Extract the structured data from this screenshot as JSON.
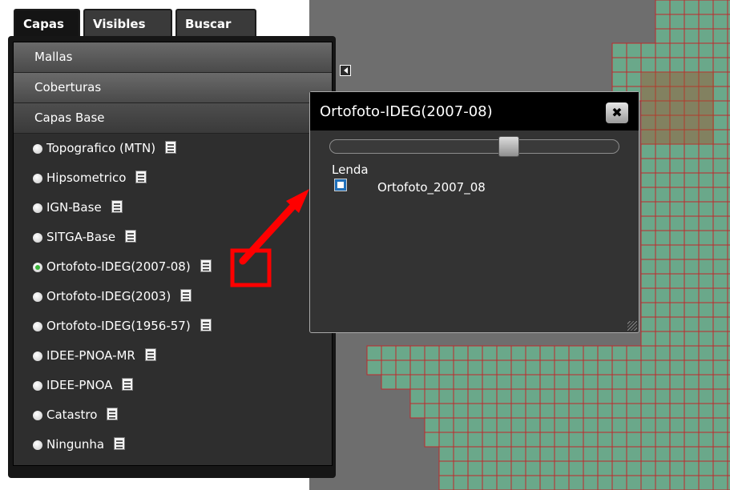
{
  "tabs": [
    {
      "label": "Capas",
      "active": true
    },
    {
      "label": "Visibles",
      "active": false
    },
    {
      "label": "Buscar",
      "active": false
    }
  ],
  "sections": {
    "mallas": "Mallas",
    "coberturas": "Coberturas",
    "capas_base": "Capas Base"
  },
  "layers": [
    {
      "label": "Topografico (MTN)",
      "checked": false
    },
    {
      "label": "Hipsometrico",
      "checked": false
    },
    {
      "label": "IGN-Base",
      "checked": false
    },
    {
      "label": "SITGA-Base",
      "checked": false
    },
    {
      "label": "Ortofoto-IDEG(2007-08)",
      "checked": true
    },
    {
      "label": "Ortofoto-IDEG(2003)",
      "checked": false
    },
    {
      "label": "Ortofoto-IDEG(1956-57)",
      "checked": false
    },
    {
      "label": "IDEE-PNOA-MR",
      "checked": false
    },
    {
      "label": "IDEE-PNOA",
      "checked": false
    },
    {
      "label": "Catastro",
      "checked": false
    },
    {
      "label": "Ningunha",
      "checked": false
    }
  ],
  "popup": {
    "title": "Ortofoto-IDEG(2007-08)",
    "close_glyph": "✖",
    "opacity_percent": 62,
    "legend_title": "Lenda",
    "legend_item": "Ortofoto_2007_08"
  },
  "colors": {
    "map_land": "#6aa88a",
    "grid_line": "#c0282c",
    "highlight": "#ff0000"
  }
}
